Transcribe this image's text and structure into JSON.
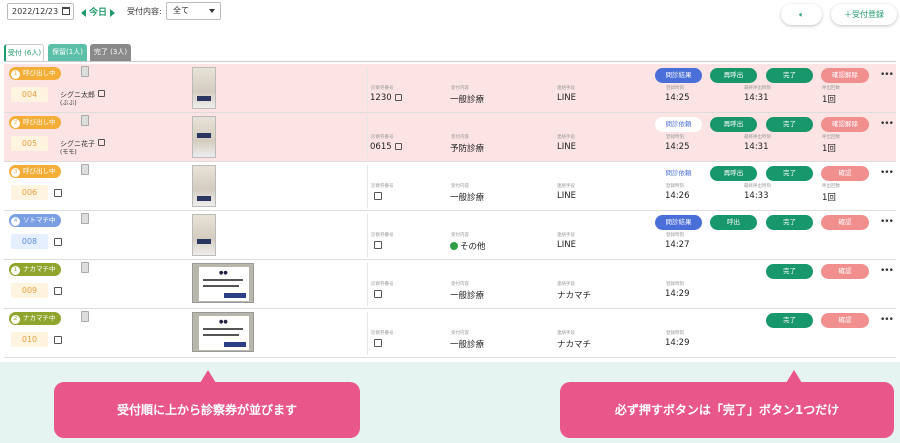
{
  "toolbar": {
    "date": "2022/12/23",
    "today_label": "今日",
    "filter_label": "受付内容:",
    "filter_value": "全て",
    "register_label": "＋受付登録"
  },
  "tabs": [
    {
      "label": "受付 (6人)"
    },
    {
      "label": "保留(1人)"
    },
    {
      "label": "完了 (3人)"
    }
  ],
  "field_labels": {
    "ticket": "診察券番号",
    "content": "受付内容",
    "contact": "連絡手段",
    "registered": "登録時刻",
    "last_call": "最終呼出時刻",
    "call_count": "呼出回数"
  },
  "colors": {
    "accent": "#17976b",
    "orange_badge": "#f4ad37",
    "blue_badge": "#7a9fe3",
    "olive_badge": "#8fa52e",
    "callout": "#e8568a"
  },
  "rows": [
    {
      "status": "呼び出し中",
      "num": "1",
      "id": "004",
      "name": "シグニ太郎",
      "kana": "(ぶぶ)",
      "ticket": "1230",
      "content": "一般診療",
      "contact": "LINE",
      "registered": "14:25",
      "last_call": "14:31",
      "call_count": "1回",
      "b_result": "問診結果",
      "b_recall": "再呼出",
      "b_done": "完了",
      "b_confirm": "確認解除"
    },
    {
      "status": "呼び出し中",
      "num": "2",
      "id": "005",
      "name": "シグニ花子",
      "kana": "(モモ)",
      "ticket": "0615",
      "content": "予防診療",
      "contact": "LINE",
      "registered": "14:25",
      "last_call": "14:31",
      "call_count": "1回",
      "b_result": "問診依頼",
      "b_recall": "再呼出",
      "b_done": "完了",
      "b_confirm": "確認解除"
    },
    {
      "status": "呼び出し中",
      "num": "3",
      "id": "006",
      "content": "一般診療",
      "contact": "LINE",
      "registered": "14:26",
      "last_call": "14:33",
      "call_count": "1回",
      "b_result": "問診依頼",
      "b_recall": "再呼出",
      "b_done": "完了",
      "b_confirm": "確認"
    },
    {
      "status": "ソトマチ中",
      "num": "4",
      "id": "008",
      "content": "その他",
      "contact": "LINE",
      "registered": "14:27",
      "b_result": "問診結果",
      "b_recall": "呼出",
      "b_done": "完了",
      "b_confirm": "確認"
    },
    {
      "status": "ナカマチ中",
      "num": "1",
      "id": "009",
      "content": "一般診療",
      "contact": "ナカマチ",
      "registered": "14:29",
      "b_done": "完了",
      "b_confirm": "確認"
    },
    {
      "status": "ナカマチ中",
      "num": "2",
      "id": "010",
      "content": "一般診療",
      "contact": "ナカマチ",
      "registered": "14:29",
      "b_done": "完了",
      "b_confirm": "確認"
    }
  ],
  "callouts": {
    "left": "受付順に上から診察券が並びます",
    "right": "必ず押すボタンは「完了」ボタン1つだけ"
  }
}
